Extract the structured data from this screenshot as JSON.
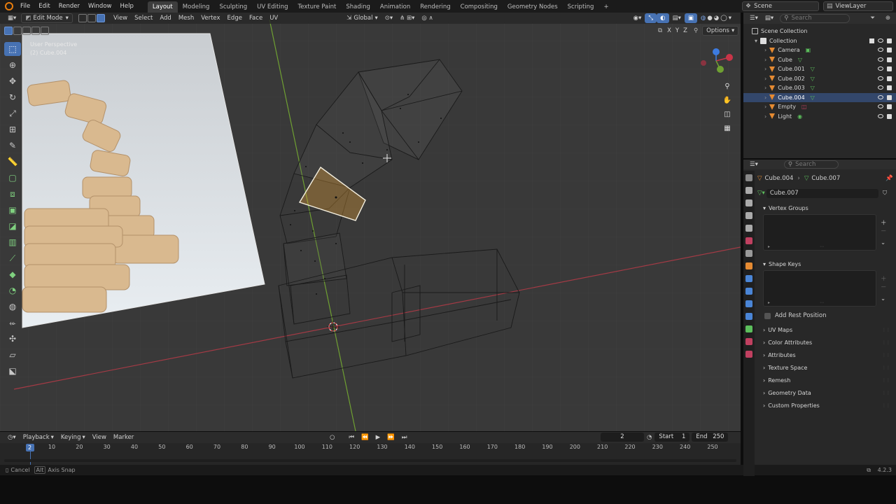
{
  "topbar": {
    "menus": [
      "File",
      "Edit",
      "Render",
      "Window",
      "Help"
    ],
    "workspaces": [
      "Layout",
      "Modeling",
      "Sculpting",
      "UV Editing",
      "Texture Paint",
      "Shading",
      "Animation",
      "Rendering",
      "Compositing",
      "Geometry Nodes",
      "Scripting"
    ],
    "active_workspace": "Layout",
    "add_tab": "+",
    "scene": "Scene",
    "view_layer": "ViewLayer"
  },
  "viewport": {
    "mode": "Edit Mode",
    "menus": [
      "View",
      "Select",
      "Add",
      "Mesh",
      "Vertex",
      "Edge",
      "Face",
      "UV"
    ],
    "orientation": "Global",
    "options": "Options",
    "axes": [
      "X",
      "Y",
      "Z"
    ],
    "info_line1": "User Perspective",
    "info_line2": "(2) Cube.004"
  },
  "timeline": {
    "menus": [
      "Playback",
      "Keying",
      "View",
      "Marker"
    ],
    "current_frame": "2",
    "start_label": "Start",
    "start": "1",
    "end_label": "End",
    "end": "250",
    "ticks": [
      "10",
      "20",
      "30",
      "40",
      "50",
      "60",
      "70",
      "80",
      "90",
      "100",
      "110",
      "120",
      "130",
      "140",
      "150",
      "160",
      "170",
      "180",
      "190",
      "200",
      "210",
      "220",
      "230",
      "240",
      "250"
    ],
    "cursor_label": "2"
  },
  "statusbar": {
    "cancel": "Cancel",
    "alt_key": "Alt",
    "axis_snap": "Axis Snap",
    "version": "4.2.3"
  },
  "outliner": {
    "search_placeholder": "Search",
    "scene_collection": "Scene Collection",
    "collection": "Collection",
    "items": [
      {
        "label": "Camera",
        "selected": false
      },
      {
        "label": "Cube",
        "selected": false
      },
      {
        "label": "Cube.001",
        "selected": false
      },
      {
        "label": "Cube.002",
        "selected": false
      },
      {
        "label": "Cube.003",
        "selected": false
      },
      {
        "label": "Cube.004",
        "selected": true
      },
      {
        "label": "Empty",
        "selected": false
      },
      {
        "label": "Light",
        "selected": false
      }
    ]
  },
  "properties": {
    "search_placeholder": "Search",
    "breadcrumb_object": "Cube.004",
    "breadcrumb_mesh": "Cube.007",
    "mesh_name": "Cube.007",
    "vertex_groups": "Vertex Groups",
    "shape_keys": "Shape Keys",
    "add_rest_position": "Add Rest Position",
    "sections": [
      "UV Maps",
      "Color Attributes",
      "Attributes",
      "Texture Space",
      "Remesh",
      "Geometry Data",
      "Custom Properties"
    ]
  },
  "colors": {
    "accent": "#4772b3",
    "selected_face": "#e8a23a",
    "x_axis": "#a33a45",
    "y_axis": "#6fa032"
  }
}
